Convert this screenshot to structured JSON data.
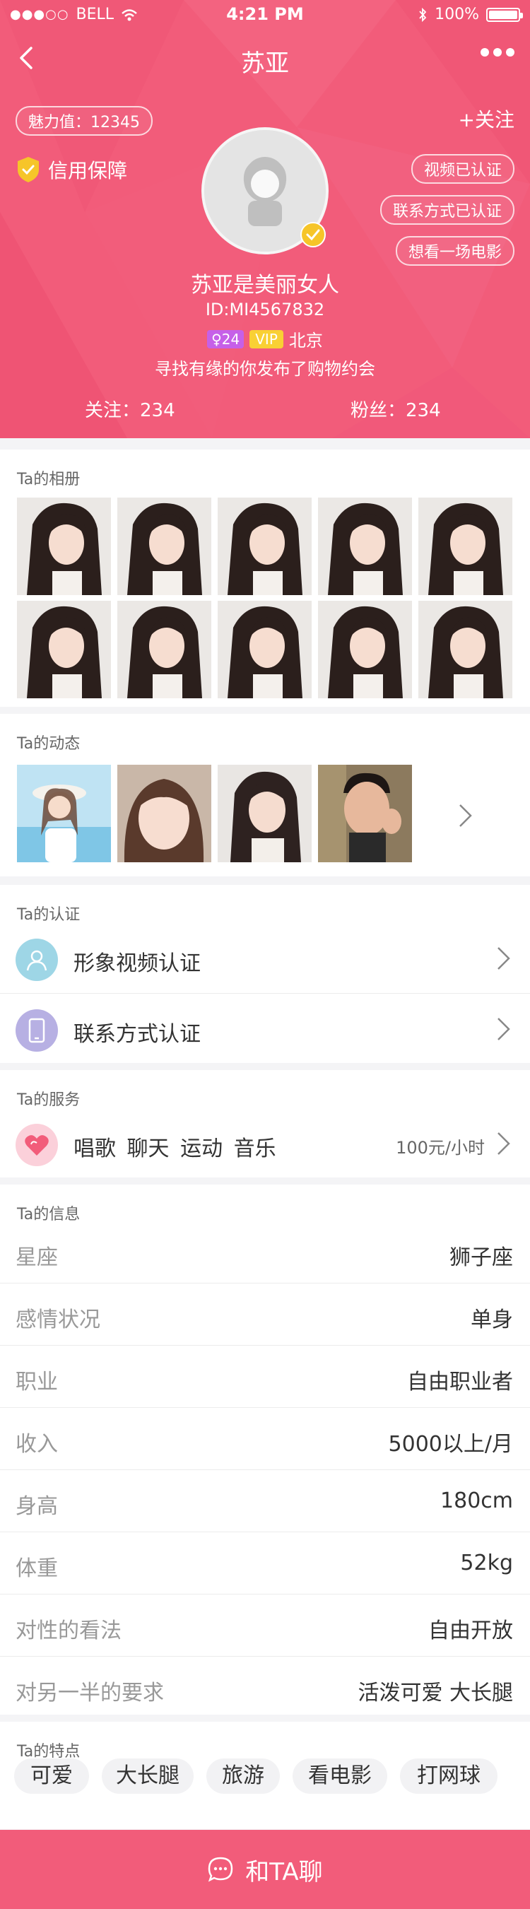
{
  "status_bar": {
    "carrier": "BELL",
    "time": "4:21 PM",
    "battery": "100%",
    "battery_level": 1.0
  },
  "nav": {
    "title": "苏亚"
  },
  "profile": {
    "charm": "魅力值：12345",
    "follow_label": "+关注",
    "credit": "信用保障",
    "verifications": [
      "视频已认证",
      "联系方式已认证",
      "想看一场电影"
    ],
    "name": "苏亚是美丽女人",
    "id": "ID:MI4567832",
    "age_tag": "24",
    "vip_tag": "VIP",
    "location": "北京",
    "intro": "寻找有缘的你发布了购物约会",
    "following": "关注：234",
    "fans": "粉丝：234"
  },
  "album": {
    "title": "Ta的相册",
    "photo_count": 10
  },
  "moments": {
    "title": "Ta的动态",
    "photo_count": 4
  },
  "certification": {
    "title": "Ta的认证",
    "items": [
      {
        "label": "形象视频认证",
        "icon": "person-icon"
      },
      {
        "label": "联系方式认证",
        "icon": "phone-icon"
      }
    ]
  },
  "services": {
    "title": "Ta的服务",
    "items": [
      "唱歌",
      "聊天",
      "运动",
      "音乐"
    ],
    "price": "100元/小时",
    "icon": "heart-icon"
  },
  "info": {
    "title": "Ta的信息",
    "rows": [
      {
        "key": "星座",
        "value": "狮子座"
      },
      {
        "key": "感情状况",
        "value": "单身"
      },
      {
        "key": "职业",
        "value": "自由职业者"
      },
      {
        "key": "收入",
        "value": "5000以上/月"
      },
      {
        "key": "身高",
        "value": "180cm"
      },
      {
        "key": "体重",
        "value": "52kg"
      },
      {
        "key": "对性的看法",
        "value": "自由开放"
      },
      {
        "key": "对另一半的要求",
        "value": "活泼可爱 大长腿"
      }
    ]
  },
  "features": {
    "title": "Ta的特点",
    "items": [
      "可爱",
      "大长腿",
      "旅游",
      "看电影",
      "打网球"
    ]
  },
  "chat_button": {
    "label": "和TA聊"
  },
  "colors": {
    "brand": "#f25c7a",
    "vip": "#f9d034",
    "age": "#c660e8",
    "credit_shield": "#f6c529"
  }
}
